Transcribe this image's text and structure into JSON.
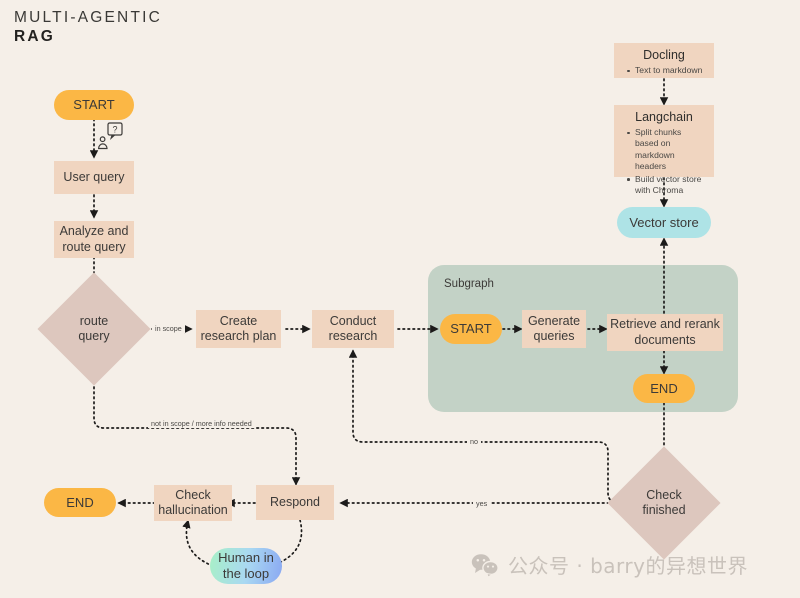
{
  "title": {
    "line1": "MULTI-AGENTIC",
    "line2": "RAG"
  },
  "nodes": {
    "start_main": "START",
    "user_query": "User query",
    "analyze_route": "Analyze and\nroute query",
    "analyze_route_l1": "Analyze and",
    "analyze_route_l2": "route query",
    "route_query_l1": "route",
    "route_query_l2": "query",
    "create_plan_l1": "Create",
    "create_plan_l2": "research plan",
    "conduct_l1": "Conduct",
    "conduct_l2": "research",
    "subgraph_title": "Subgraph",
    "start_sub": "START",
    "generate_l1": "Generate",
    "generate_l2": "queries",
    "retrieve_l1": "Retrieve and rerank",
    "retrieve_l2": "documents",
    "end_sub": "END",
    "check_finished_l1": "Check",
    "check_finished_l2": "finished",
    "respond": "Respond",
    "check_halluc_l1": "Check",
    "check_halluc_l2": "hallucination",
    "end_main": "END",
    "human_loop_l1": "Human in",
    "human_loop_l2": "the loop",
    "vector_store": "Vector   store"
  },
  "cards": {
    "docling": {
      "title": "Docling",
      "bullets": [
        "Text to markdown"
      ]
    },
    "langchain": {
      "title": "Langchain",
      "bullets": [
        "Split chunks based on markdown headers",
        "Build vector   store with Chroma"
      ]
    }
  },
  "edge_labels": {
    "in_scope": "in scope",
    "not_in_scope": "not in scope / more info needed",
    "no": "no",
    "yes": "yes"
  },
  "watermark": {
    "text": "公众号 · barry的异想世界",
    "icon": "wechat-icon"
  },
  "colors": {
    "background": "#f5efe8",
    "box": "#f0d5c0",
    "pill_orange": "#fbb745",
    "pill_blue": "#aee3e6",
    "diamond": "#ddc7be",
    "subgraph": "#c3d2c6",
    "edge": "#1c1b1a"
  }
}
